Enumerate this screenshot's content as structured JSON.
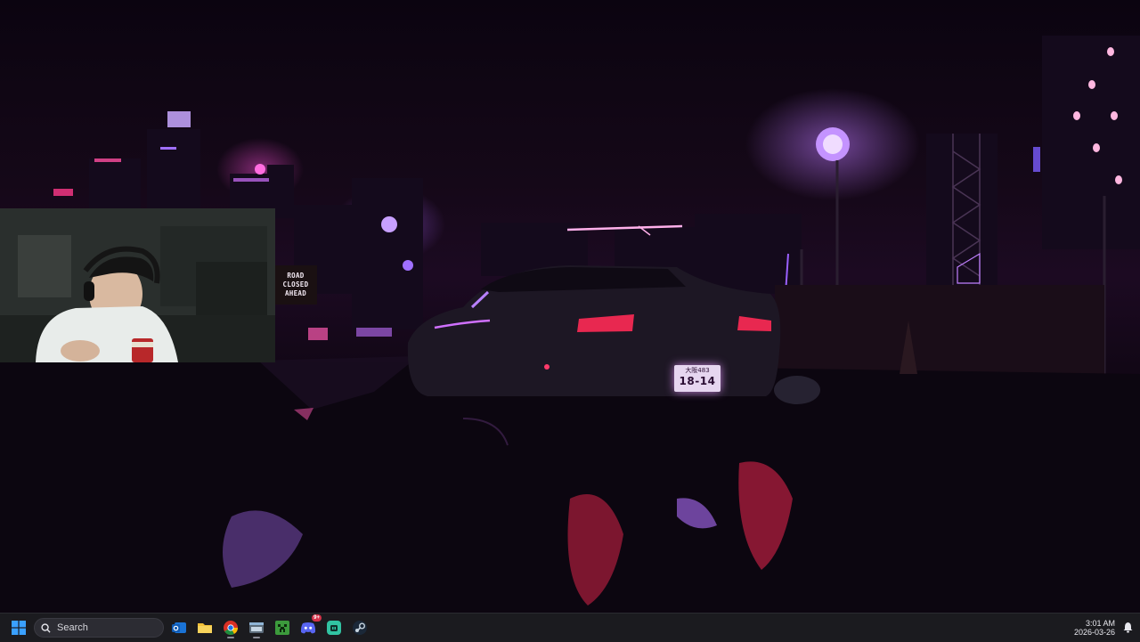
{
  "desktop": {
    "wallpaper": {
      "sign_lines": [
        "ROAD",
        "CLOSED",
        "AHEAD"
      ],
      "plate_top": "大阪483",
      "plate_number": "18-14"
    }
  },
  "webcam": {
    "label": "webcam-overlay"
  },
  "taskbar": {
    "search_label": "Search",
    "apps": [
      {
        "name": "Start",
        "icon": "windows-logo-icon"
      },
      {
        "name": "Outlook",
        "icon": "outlook-icon"
      },
      {
        "name": "File Explorer",
        "icon": "folder-icon"
      },
      {
        "name": "Chrome",
        "icon": "chrome-icon"
      },
      {
        "name": "App window",
        "icon": "window-icon"
      },
      {
        "name": "Minecraft",
        "icon": "minecraft-icon"
      },
      {
        "name": "Discord",
        "icon": "discord-icon",
        "badge": "9+"
      },
      {
        "name": "Streamlabs",
        "icon": "streamlabs-icon"
      },
      {
        "name": "Steam",
        "icon": "steam-icon"
      }
    ],
    "clock": {
      "time": "3:01 AM",
      "date": "2026-03-26"
    }
  },
  "colors": {
    "taskbar_bg": "#1b1b1f",
    "neon_purple": "#b070ff",
    "neon_pink": "#ff3a8a",
    "windows_blue": "#0a84ff"
  }
}
